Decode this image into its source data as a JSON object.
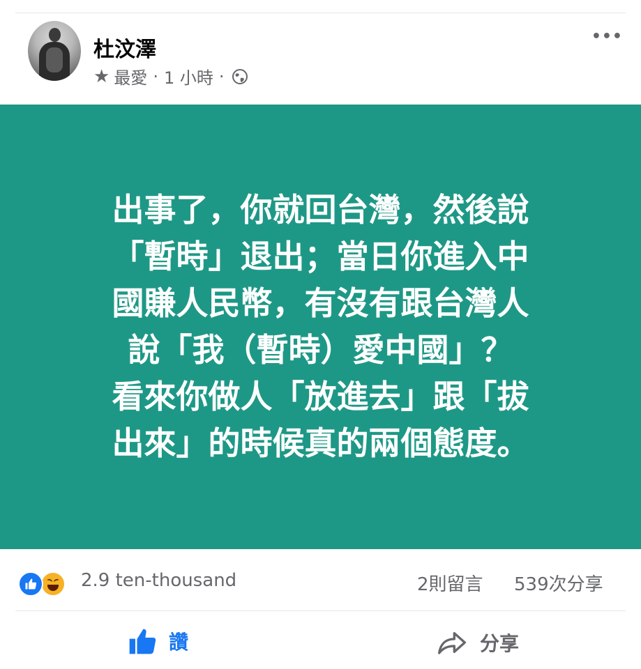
{
  "post": {
    "author": "杜汶澤",
    "meta": {
      "star_icon": "star-icon",
      "audience_label": "最愛",
      "separator": "·",
      "time": "1 小時",
      "privacy_icon": "globe-icon"
    },
    "more_icon": "more-horizontal-icon",
    "card": {
      "background": "#1e9886",
      "text": "出事了，你就回台灣，然後說\n「暫時」退出；當日你進入中\n國賺人民幣，有沒有跟台灣人\n說「我（暫時）愛中國」？\n看來你做人「放進去」跟「拔\n出來」的時候真的兩個態度。"
    }
  },
  "stats": {
    "reactions_icons": [
      "like-icon",
      "haha-icon"
    ],
    "reactions_count": "2.9 ten-thousand",
    "comments": "2則留言",
    "shares": "539次分享"
  },
  "actions": {
    "like_label": "讚",
    "share_label": "分享",
    "like_color": "#1877f2"
  }
}
